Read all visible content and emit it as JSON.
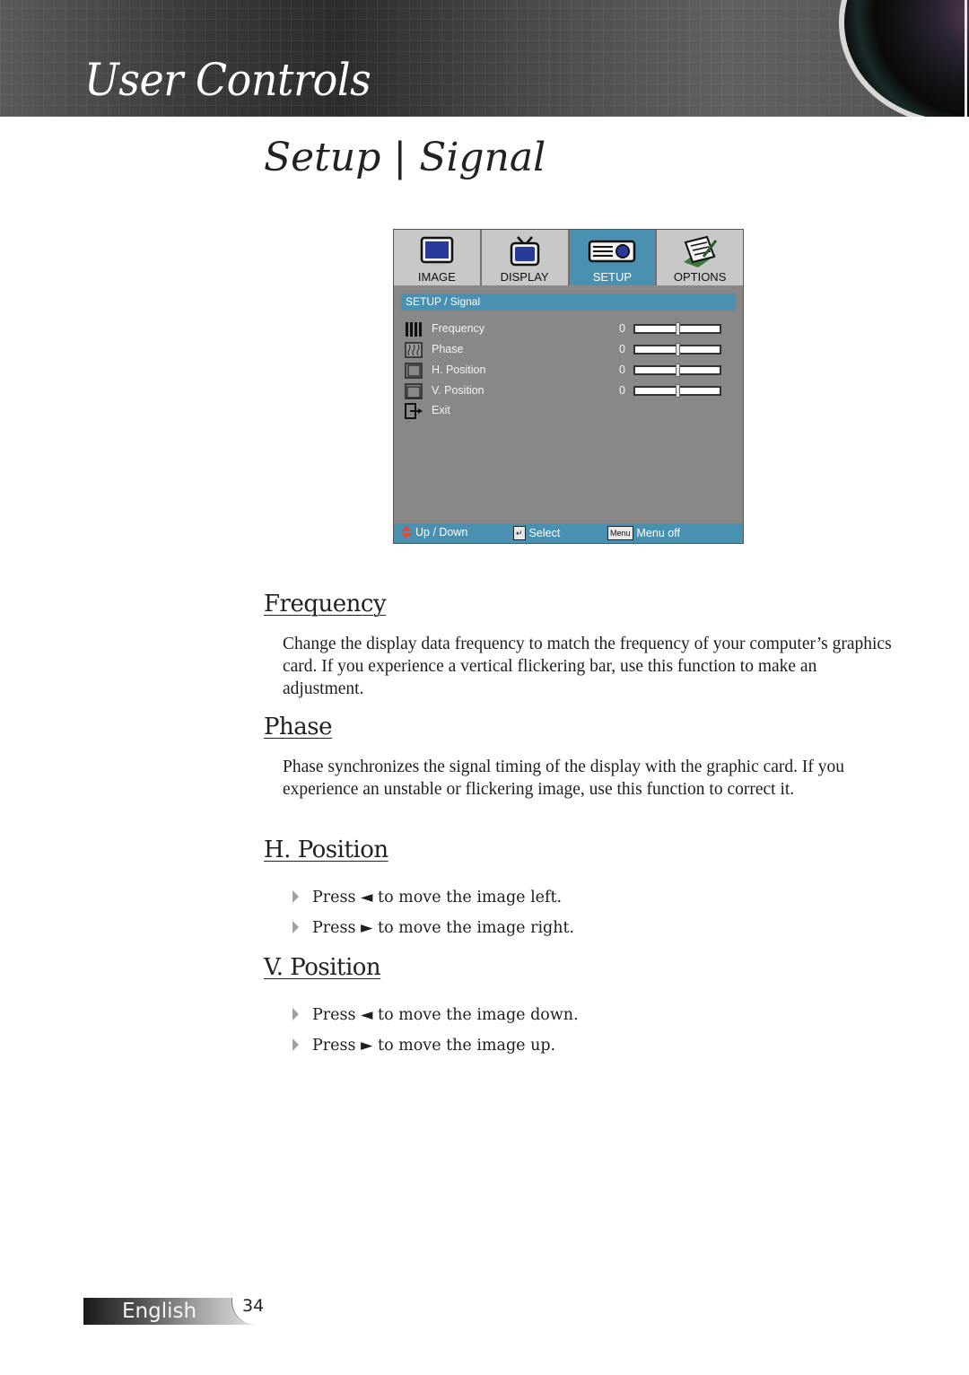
{
  "header": {
    "title": "User Controls"
  },
  "page_title": {
    "left": "Setup",
    "separator": "|",
    "right": "Signal"
  },
  "osd": {
    "tabs": [
      {
        "label": "IMAGE",
        "icon": "monitor-icon",
        "active": false
      },
      {
        "label": "DISPLAY",
        "icon": "tv-icon",
        "active": false
      },
      {
        "label": "SETUP",
        "icon": "projector-icon",
        "active": true
      },
      {
        "label": "OPTIONS",
        "icon": "notepad-icon",
        "active": false
      }
    ],
    "breadcrumb": "SETUP / Signal",
    "items": [
      {
        "label": "Frequency",
        "icon": "frequency-icon",
        "value": "0",
        "slider_fraction": 0.5
      },
      {
        "label": "Phase",
        "icon": "phase-icon",
        "value": "0",
        "slider_fraction": 0.5
      },
      {
        "label": "H. Position",
        "icon": "h-position-icon",
        "value": "0",
        "slider_fraction": 0.5
      },
      {
        "label": "V. Position",
        "icon": "v-position-icon",
        "value": "0",
        "slider_fraction": 0.5
      },
      {
        "label": "Exit",
        "icon": "exit-icon"
      }
    ],
    "footer": {
      "updown": "Up / Down",
      "select": "Select",
      "menu_key": "Menu",
      "menu_off": "Menu off"
    },
    "colors": {
      "accent": "#4a90b0",
      "panel": "#888888",
      "tab": "#c8c8c8"
    }
  },
  "sections": {
    "frequency": {
      "heading": "Frequency",
      "text": "Change the display data frequency to match the frequency of your computer’s graphics card. If you experience a vertical flickering bar, use this function to make an adjustment."
    },
    "phase": {
      "heading": "Phase",
      "text": "Phase synchronizes the signal timing of the display with the graphic card. If you experience an unstable or flickering image, use this function to correct it."
    },
    "h_position": {
      "heading": "H. Position",
      "bullets": [
        "Press ◄ to move the image left.",
        "Press ► to move the image right."
      ]
    },
    "v_position": {
      "heading": "V. Position",
      "bullets": [
        "Press ◄ to move the image down.",
        "Press ► to move the image up."
      ]
    }
  },
  "footer": {
    "language": "English",
    "page_number": "34"
  }
}
